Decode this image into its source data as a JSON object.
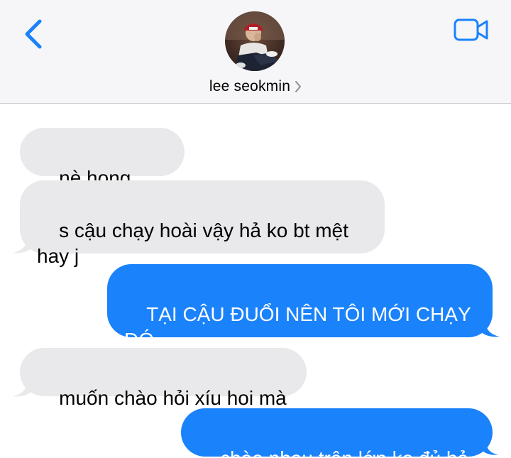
{
  "header": {
    "contact_name": "lee seokmin",
    "back_icon": "chevron-left-icon",
    "video_icon": "video-camera-icon",
    "accent": "#1a82fb"
  },
  "messages": [
    {
      "direction": "incoming",
      "text": "nè hong jisoo"
    },
    {
      "direction": "incoming",
      "text": "s cậu chạy hoài vậy hả ko bt mệt\nhay j"
    },
    {
      "direction": "outgoing",
      "text": "TẠI CẬU ĐUỔI NÊN TÔI MỚI CHẠY\nĐÓ"
    },
    {
      "direction": "incoming",
      "text": "muốn chào hỏi xíu hoi mà"
    },
    {
      "direction": "outgoing",
      "text": "chào nhau trên lớp ko đủ hả"
    }
  ],
  "colors": {
    "incoming_bubble": "#e9e9eb",
    "outgoing_bubble": "#1a82fb"
  }
}
